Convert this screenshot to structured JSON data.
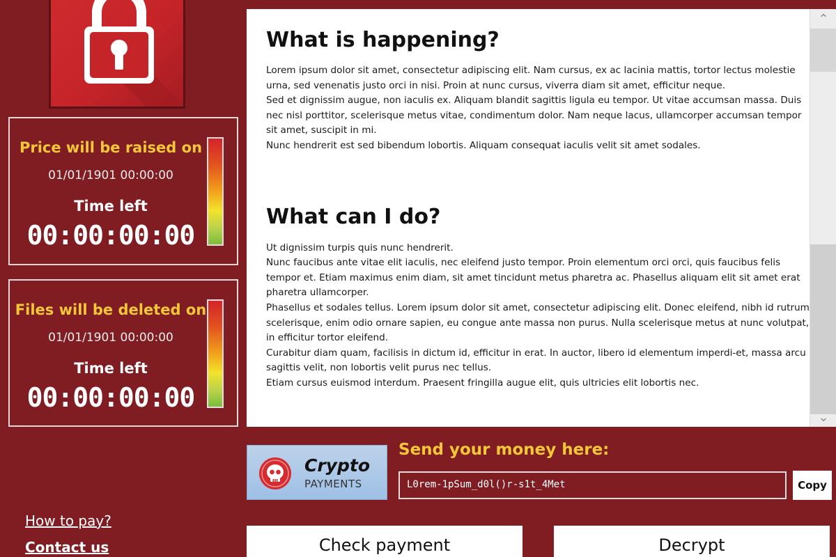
{
  "colors": {
    "background": "#7f1d22",
    "accent_yellow": "#f4c73a",
    "lock_tile": "#c52429",
    "text_panel": "#ffffff",
    "crypto_badge": "#a9c6e6"
  },
  "logo": {
    "icon": "padlock-icon"
  },
  "price_panel": {
    "heading": "Price will be raised on",
    "date": "01/01/1901 00:00:00",
    "time_left_label": "Time left",
    "timer": "00:00:00:00"
  },
  "delete_panel": {
    "heading": "Files will be deleted on",
    "date": "01/01/1901 00:00:00",
    "time_left_label": "Time left",
    "timer": "00:00:00:00"
  },
  "info": {
    "section1_title": "What is happening?",
    "section1_paragraphs": [
      "Lorem ipsum dolor sit amet, consectetur adipiscing elit. Nam cursus, ex ac lacinia mattis, tortor lectus molestie urna, sed venenatis justo orci in nisi. Proin at nunc cursus, viverra diam sit amet, efficitur neque.",
      "Sed et dignissim augue, non iaculis ex. Aliquam blandit sagittis ligula eu tempor. Ut vitae accumsan massa. Duis nec nisl porttitor, scelerisque metus vitae, condimentum dolor. Nam neque lacus, ullamcorper accumsan tempor sit amet, suscipit in mi.",
      "Nunc hendrerit est sed bibendum lobortis. Aliquam consequat iaculis velit sit amet sodales."
    ],
    "section2_title": "What can I do?",
    "section2_paragraphs": [
      "Ut dignissim turpis quis nunc hendrerit.",
      "Nunc faucibus ante vitae elit iaculis, nec eleifend justo tempor. Proin elementum orci orci, quis faucibus felis tempor et. Etiam maximus enim diam, sit amet tincidunt metus pharetra ac. Phasellus aliquam elit sit amet erat pharetra ullamcorper.",
      "Phasellus et sodales tellus. Lorem ipsum dolor sit amet, consectetur adipiscing elit. Donec eleifend, nibh id rutrum scelerisque, enim odio ornare sapien, eu congue ante massa non purus. Nulla scelerisque metus at nunc volutpat, in efficitur tortor eleifend.",
      "Curabitur diam quam, facilisis in dictum id, efficitur in erat. In auctor, libero id elementum imperdi-et, massa arcu sagittis velit, non lobortis velit purus nec tellus.",
      "Etiam cursus euismod interdum. Praesent fringilla augue elit, quis ultricies elit lobortis nec."
    ]
  },
  "payment": {
    "badge_word": "Crypto",
    "badge_subword": "PAYMENTS",
    "badge_icon": "skull-icon",
    "send_label": "Send your money here:",
    "address": "L0rem-1pSum_d0l()r-s1t_4Met",
    "copy_label": "Copy"
  },
  "links": {
    "how_to_pay": "How to pay?",
    "contact_us": "Contact us"
  },
  "actions": {
    "check_payment": "Check payment",
    "decrypt": "Decrypt"
  }
}
